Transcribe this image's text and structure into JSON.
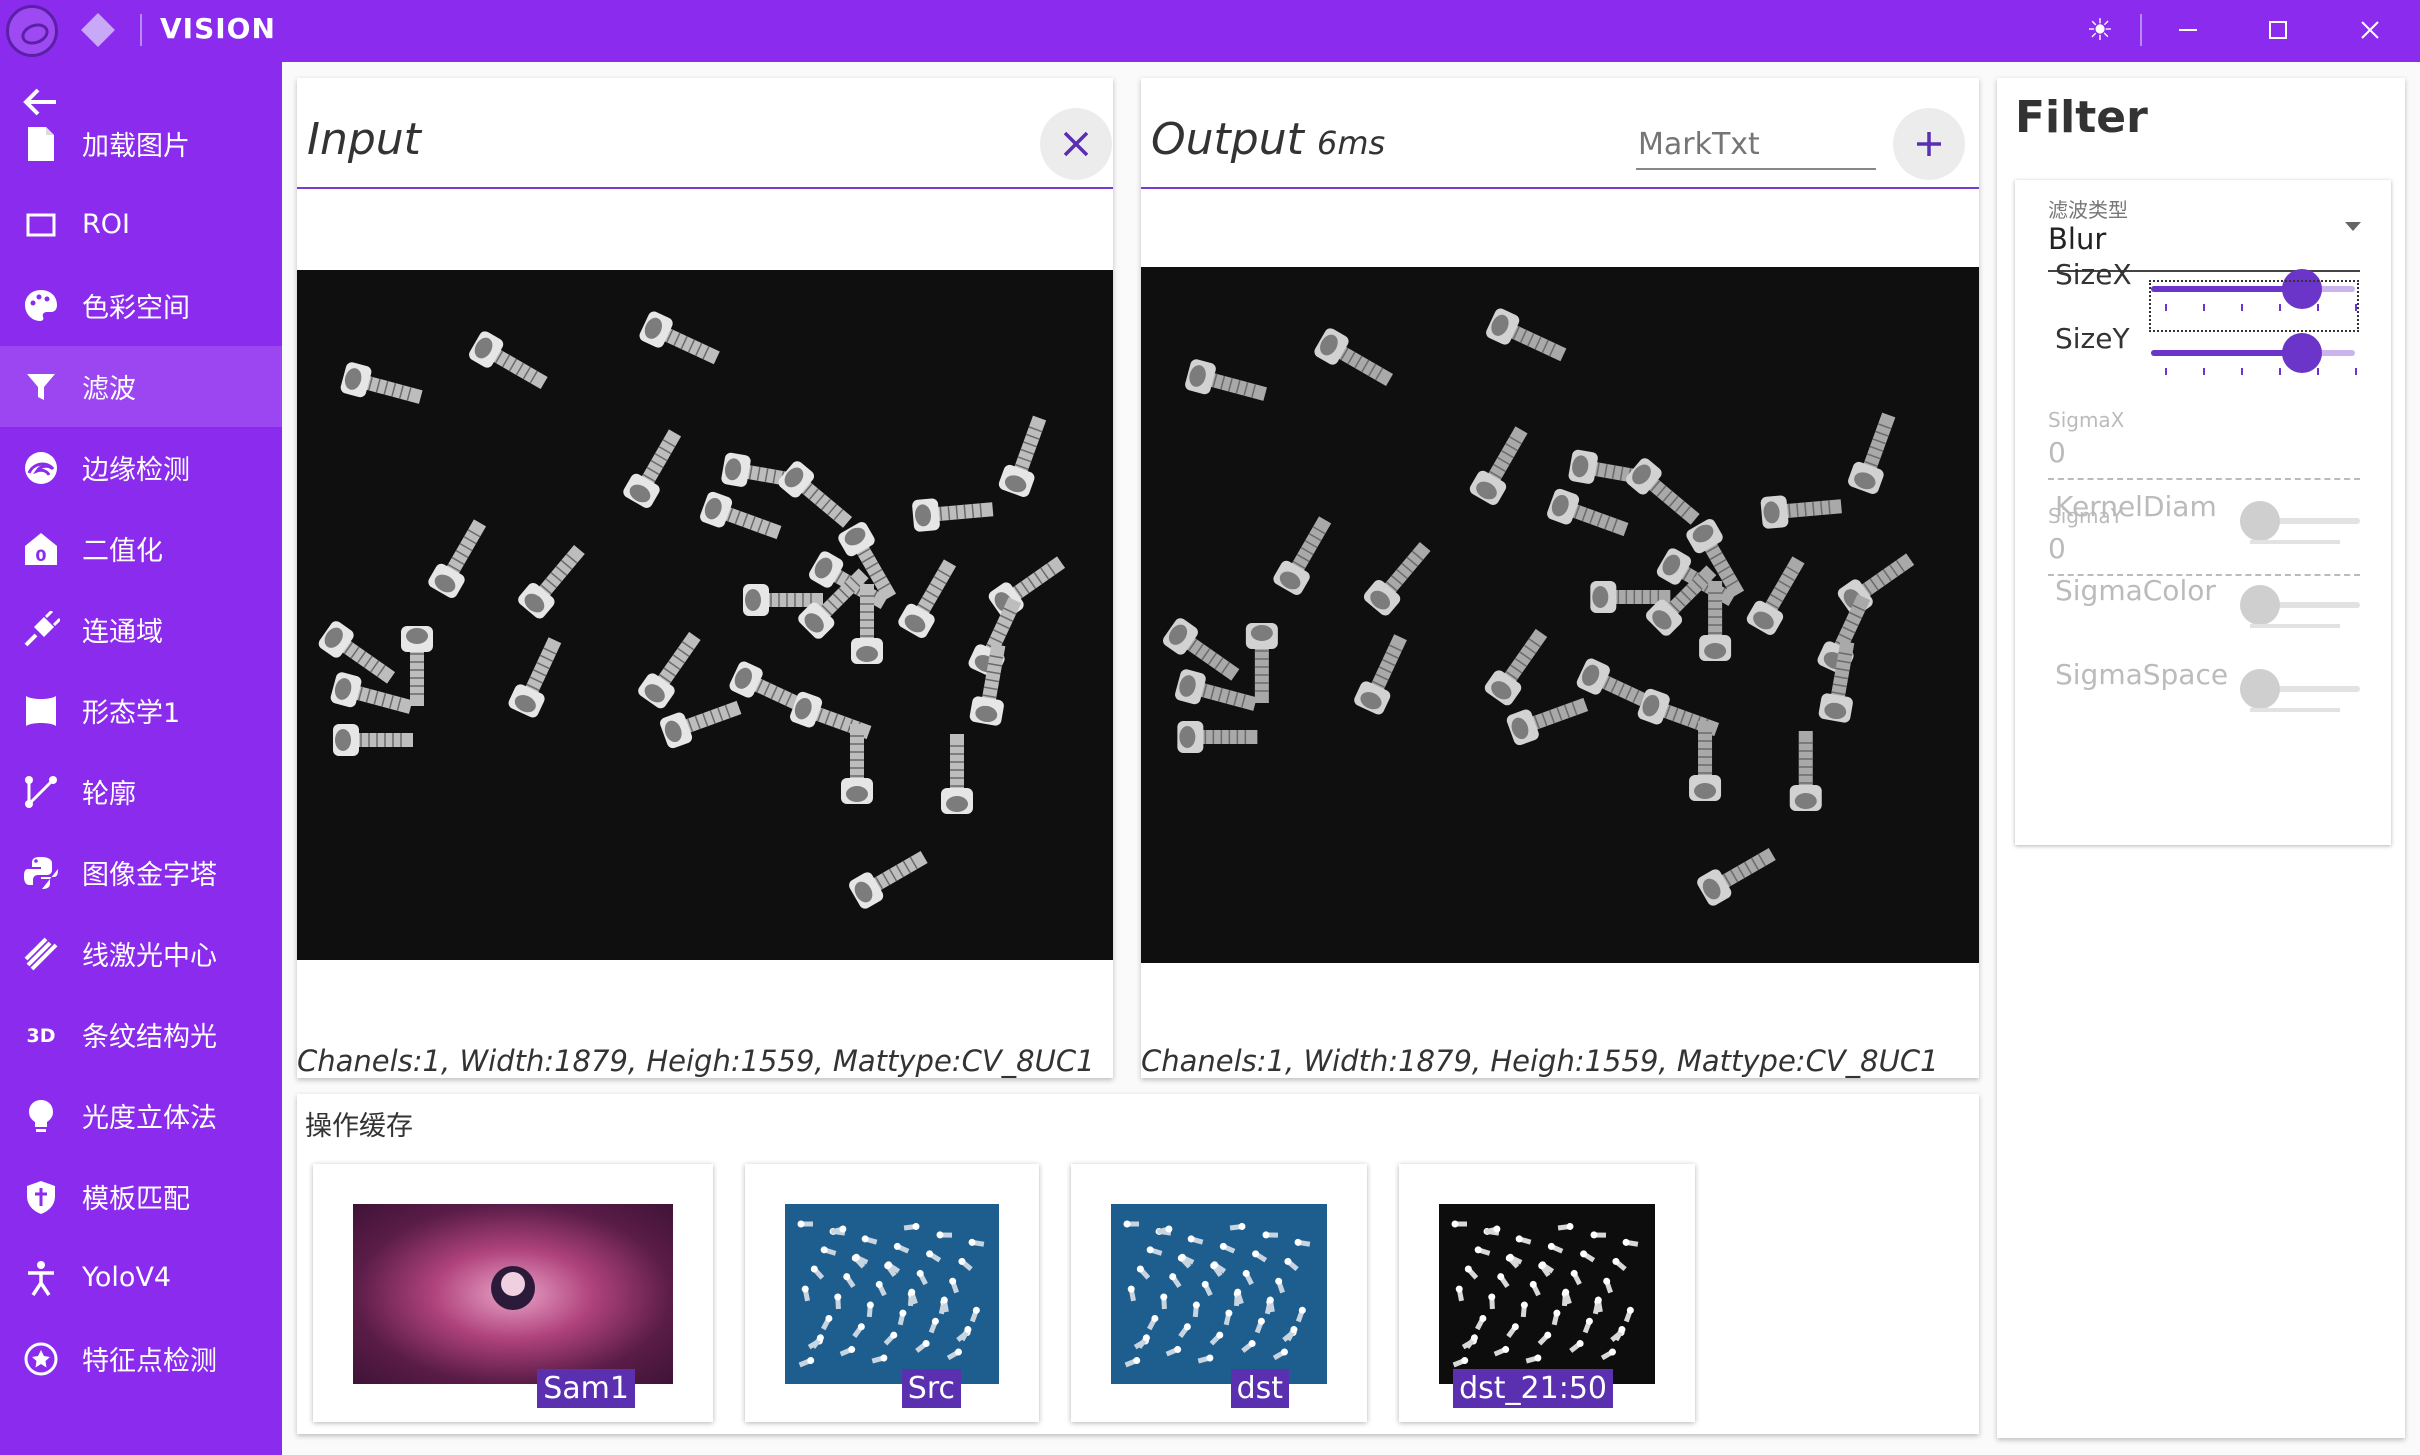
{
  "window": {
    "title": "VISION",
    "controls": [
      "theme-icon",
      "minimize-icon",
      "maximize-icon",
      "close-icon"
    ]
  },
  "sidebar": {
    "back_icon": "arrow-left-icon",
    "items": [
      {
        "label": "加载图片",
        "icon": "file-icon",
        "active": false
      },
      {
        "label": "ROI",
        "icon": "rectangle-icon",
        "active": false
      },
      {
        "label": "色彩空间",
        "icon": "palette-icon",
        "active": false
      },
      {
        "label": "滤波",
        "icon": "filter-icon",
        "active": true
      },
      {
        "label": "边缘检测",
        "icon": "edge-icon",
        "active": false
      },
      {
        "label": "二值化",
        "icon": "binary-icon",
        "active": false
      },
      {
        "label": "连通域",
        "icon": "plug-icon",
        "active": false
      },
      {
        "label": "形态学1",
        "icon": "morph-icon",
        "active": false
      },
      {
        "label": "轮廓",
        "icon": "contour-icon",
        "active": false
      },
      {
        "label": "图像金字塔",
        "icon": "python-icon",
        "active": false
      },
      {
        "label": "线激光中心",
        "icon": "laser-icon",
        "active": false
      },
      {
        "label": "条纹结构光",
        "icon": "3d-icon",
        "active": false
      },
      {
        "label": "光度立体法",
        "icon": "bulb-icon",
        "active": false
      },
      {
        "label": "模板匹配",
        "icon": "shield-icon",
        "active": false
      },
      {
        "label": "YoloV4",
        "icon": "person-icon",
        "active": false
      },
      {
        "label": "特征点检测",
        "icon": "star-circle-icon",
        "active": false
      }
    ]
  },
  "input_panel": {
    "title": "Input",
    "info": "Chanels:1, Width:1879, Heigh:1559, Mattype:CV_8UC1"
  },
  "output_panel": {
    "title": "Output",
    "time": "6ms",
    "mark_placeholder": "MarkTxt",
    "info": "Chanels:1, Width:1879, Heigh:1559, Mattype:CV_8UC1"
  },
  "filter": {
    "title": "Filter",
    "type_caption": "滤波类型",
    "type_value": "Blur",
    "sliders": [
      {
        "label": "SizeX",
        "value": 0.74,
        "enabled": true
      },
      {
        "label": "SizeY",
        "value": 0.74,
        "enabled": true
      },
      {
        "label": "KernelDiam",
        "value": 0,
        "enabled": false
      },
      {
        "label": "SigmaColor",
        "value": 0,
        "enabled": false
      },
      {
        "label": "SigmaSpace",
        "value": 0,
        "enabled": false
      }
    ],
    "sigma_x": {
      "caption": "SigmaX",
      "value": "0"
    },
    "sigma_y": {
      "caption": "SigmaY",
      "value": "0"
    }
  },
  "cache": {
    "title": "操作缓存",
    "items": [
      {
        "label": "Sam1",
        "theme": "pink"
      },
      {
        "label": "Src",
        "theme": "blue"
      },
      {
        "label": "dst",
        "theme": "blue"
      },
      {
        "label": "dst_21:50",
        "theme": "dark"
      }
    ]
  },
  "colors": {
    "accent": "#8A2BEE",
    "active_nav": "#9C46F2",
    "slider": "#6A35C8",
    "label_bg": "#5A2FB0"
  }
}
